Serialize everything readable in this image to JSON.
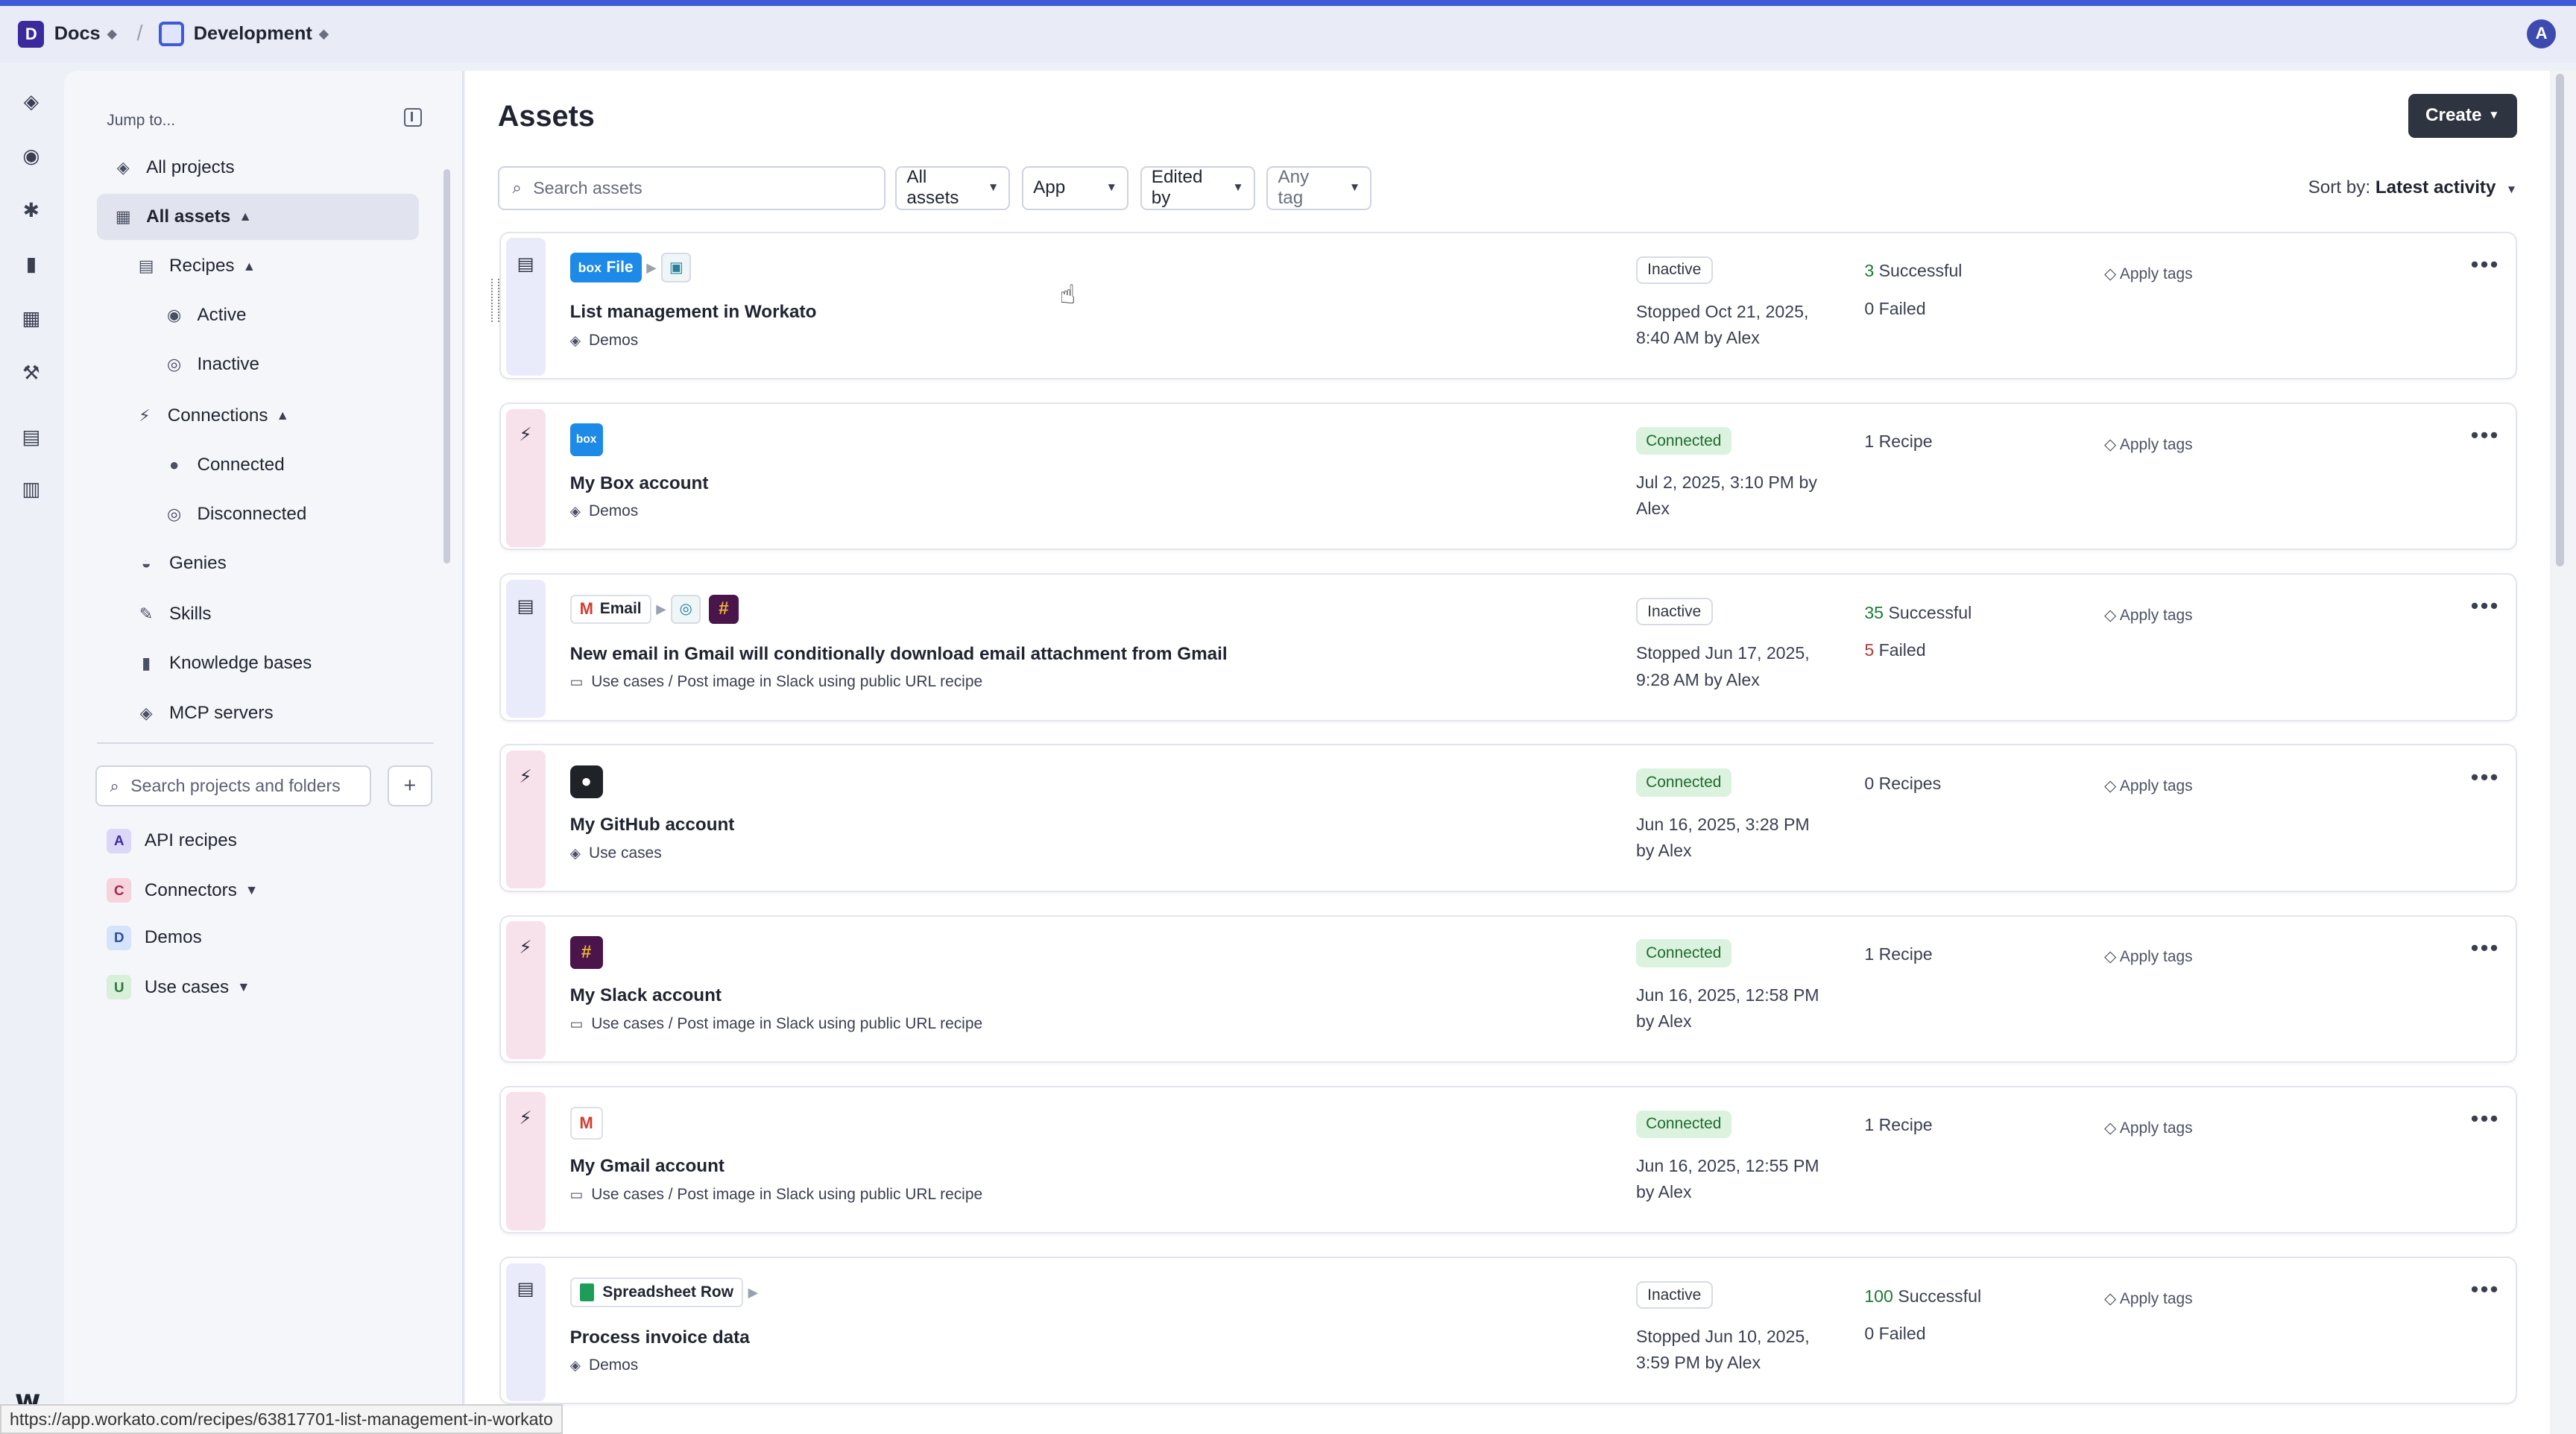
{
  "topbar": {
    "workspace_badge": "D",
    "workspace": "Docs",
    "environment": "Development",
    "avatar": "A"
  },
  "rail_icons": [
    "layers-icon",
    "compass-icon",
    "asterisk-icon",
    "book-icon",
    "dashboard-icon",
    "wrench-icon",
    "tools-icon",
    "settings-db-icon"
  ],
  "sidebar": {
    "jump_to": "Jump to...",
    "nav": {
      "all_projects": "All projects",
      "all_assets": "All assets",
      "recipes": "Recipes",
      "active": "Active",
      "inactive": "Inactive",
      "connections": "Connections",
      "connected": "Connected",
      "disconnected": "Disconnected",
      "genies": "Genies",
      "skills": "Skills",
      "knowledge_bases": "Knowledge bases",
      "mcp_servers": "MCP servers"
    },
    "search_placeholder": "Search projects and folders",
    "add_label": "+",
    "projects": [
      {
        "badge": "A",
        "name": "API recipes",
        "color": "#dcd7f7"
      },
      {
        "badge": "C",
        "name": "Connectors",
        "color": "#f6d4dc"
      },
      {
        "badge": "D",
        "name": "Demos",
        "color": "#d6e4fb"
      },
      {
        "badge": "U",
        "name": "Use cases",
        "color": "#d8efd9"
      }
    ]
  },
  "main": {
    "title": "Assets",
    "create_label": "Create",
    "search_placeholder": "Search assets",
    "filters": {
      "type": "All assets",
      "app": "App",
      "edited_by": "Edited by",
      "tag": "Any tag"
    },
    "sort_prefix": "Sort by:",
    "sort_value": "Latest activity"
  },
  "cards": [
    {
      "title": "List management in Workato",
      "subtitle": "Demos",
      "status": "Inactive",
      "meta_1": "Stopped Oct 21, 2025,",
      "meta_2": "8:40 AM by Alex",
      "stat1_num": "3",
      "stat1_label": "Successful",
      "stat2_num": "0",
      "stat2_label": "Failed",
      "tags_label": "Apply tags",
      "chip_box_label": "File"
    },
    {
      "title": "My Box account",
      "subtitle": "Demos",
      "status": "Connected",
      "meta_1": "Jul 2, 2025, 3:10 PM by",
      "meta_2": "Alex",
      "stat1_text": "1 Recipe",
      "tags_label": "Apply tags"
    },
    {
      "title": "New email in Gmail will conditionally download email attachment from Gmail",
      "subtitle": "Use cases / Post image in Slack using public URL recipe",
      "status": "Inactive",
      "meta_1": "Stopped Jun 17, 2025,",
      "meta_2": "9:28 AM by Alex",
      "stat1_num": "35",
      "stat1_label": "Successful",
      "stat2_num": "5",
      "stat2_label": "Failed",
      "tags_label": "Apply tags",
      "chip_label": "Email"
    },
    {
      "title": "My GitHub account",
      "subtitle": "Use cases",
      "status": "Connected",
      "meta_1": "Jun 16, 2025, 3:28 PM",
      "meta_2": "by Alex",
      "stat1_text": "0 Recipes",
      "tags_label": "Apply tags"
    },
    {
      "title": "My Slack account",
      "subtitle": "Use cases / Post image in Slack using public URL recipe",
      "status": "Connected",
      "meta_1": "Jun 16, 2025, 12:58 PM",
      "meta_2": "by Alex",
      "stat1_text": "1 Recipe",
      "tags_label": "Apply tags"
    },
    {
      "title": "My Gmail account",
      "subtitle": "Use cases / Post image in Slack using public URL recipe",
      "status": "Connected",
      "meta_1": "Jun 16, 2025, 12:55 PM",
      "meta_2": "by Alex",
      "stat1_text": "1 Recipe",
      "tags_label": "Apply tags"
    },
    {
      "title": "Process invoice data",
      "subtitle": "Demos",
      "status": "Inactive",
      "meta_1": "Stopped Jun 10, 2025,",
      "meta_2": "3:59 PM by Alex",
      "stat1_num": "100",
      "stat1_label": "Successful",
      "stat2_num": "0",
      "stat2_label": "Failed",
      "tags_label": "Apply tags",
      "chip_label": "Spreadsheet Row"
    }
  ],
  "status_bar_url": "https://app.workato.com/recipes/63817701-list-management-in-workato"
}
